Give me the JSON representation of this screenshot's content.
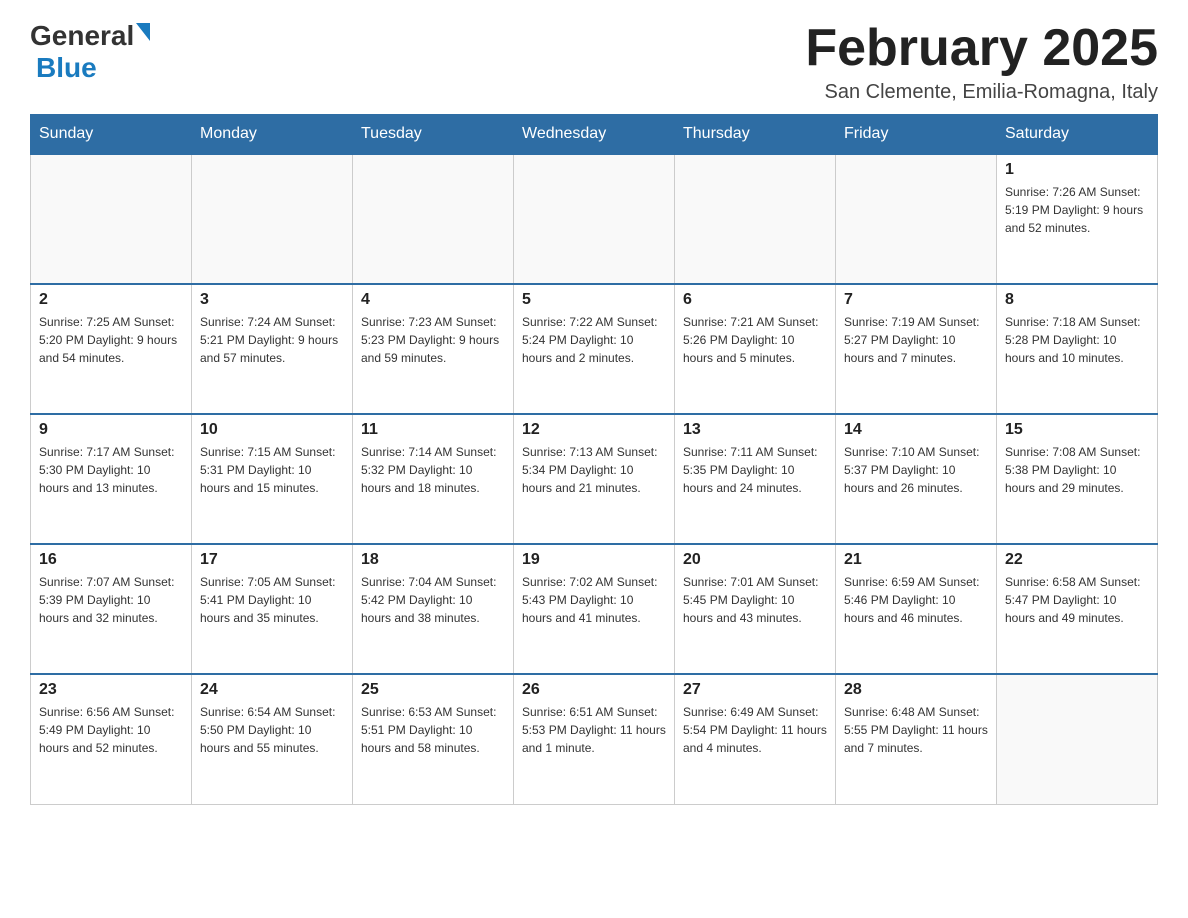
{
  "header": {
    "logo_general": "General",
    "logo_blue": "Blue",
    "title": "February 2025",
    "location": "San Clemente, Emilia-Romagna, Italy"
  },
  "days_of_week": [
    "Sunday",
    "Monday",
    "Tuesday",
    "Wednesday",
    "Thursday",
    "Friday",
    "Saturday"
  ],
  "weeks": [
    [
      {
        "day": "",
        "info": ""
      },
      {
        "day": "",
        "info": ""
      },
      {
        "day": "",
        "info": ""
      },
      {
        "day": "",
        "info": ""
      },
      {
        "day": "",
        "info": ""
      },
      {
        "day": "",
        "info": ""
      },
      {
        "day": "1",
        "info": "Sunrise: 7:26 AM\nSunset: 5:19 PM\nDaylight: 9 hours and 52 minutes."
      }
    ],
    [
      {
        "day": "2",
        "info": "Sunrise: 7:25 AM\nSunset: 5:20 PM\nDaylight: 9 hours and 54 minutes."
      },
      {
        "day": "3",
        "info": "Sunrise: 7:24 AM\nSunset: 5:21 PM\nDaylight: 9 hours and 57 minutes."
      },
      {
        "day": "4",
        "info": "Sunrise: 7:23 AM\nSunset: 5:23 PM\nDaylight: 9 hours and 59 minutes."
      },
      {
        "day": "5",
        "info": "Sunrise: 7:22 AM\nSunset: 5:24 PM\nDaylight: 10 hours and 2 minutes."
      },
      {
        "day": "6",
        "info": "Sunrise: 7:21 AM\nSunset: 5:26 PM\nDaylight: 10 hours and 5 minutes."
      },
      {
        "day": "7",
        "info": "Sunrise: 7:19 AM\nSunset: 5:27 PM\nDaylight: 10 hours and 7 minutes."
      },
      {
        "day": "8",
        "info": "Sunrise: 7:18 AM\nSunset: 5:28 PM\nDaylight: 10 hours and 10 minutes."
      }
    ],
    [
      {
        "day": "9",
        "info": "Sunrise: 7:17 AM\nSunset: 5:30 PM\nDaylight: 10 hours and 13 minutes."
      },
      {
        "day": "10",
        "info": "Sunrise: 7:15 AM\nSunset: 5:31 PM\nDaylight: 10 hours and 15 minutes."
      },
      {
        "day": "11",
        "info": "Sunrise: 7:14 AM\nSunset: 5:32 PM\nDaylight: 10 hours and 18 minutes."
      },
      {
        "day": "12",
        "info": "Sunrise: 7:13 AM\nSunset: 5:34 PM\nDaylight: 10 hours and 21 minutes."
      },
      {
        "day": "13",
        "info": "Sunrise: 7:11 AM\nSunset: 5:35 PM\nDaylight: 10 hours and 24 minutes."
      },
      {
        "day": "14",
        "info": "Sunrise: 7:10 AM\nSunset: 5:37 PM\nDaylight: 10 hours and 26 minutes."
      },
      {
        "day": "15",
        "info": "Sunrise: 7:08 AM\nSunset: 5:38 PM\nDaylight: 10 hours and 29 minutes."
      }
    ],
    [
      {
        "day": "16",
        "info": "Sunrise: 7:07 AM\nSunset: 5:39 PM\nDaylight: 10 hours and 32 minutes."
      },
      {
        "day": "17",
        "info": "Sunrise: 7:05 AM\nSunset: 5:41 PM\nDaylight: 10 hours and 35 minutes."
      },
      {
        "day": "18",
        "info": "Sunrise: 7:04 AM\nSunset: 5:42 PM\nDaylight: 10 hours and 38 minutes."
      },
      {
        "day": "19",
        "info": "Sunrise: 7:02 AM\nSunset: 5:43 PM\nDaylight: 10 hours and 41 minutes."
      },
      {
        "day": "20",
        "info": "Sunrise: 7:01 AM\nSunset: 5:45 PM\nDaylight: 10 hours and 43 minutes."
      },
      {
        "day": "21",
        "info": "Sunrise: 6:59 AM\nSunset: 5:46 PM\nDaylight: 10 hours and 46 minutes."
      },
      {
        "day": "22",
        "info": "Sunrise: 6:58 AM\nSunset: 5:47 PM\nDaylight: 10 hours and 49 minutes."
      }
    ],
    [
      {
        "day": "23",
        "info": "Sunrise: 6:56 AM\nSunset: 5:49 PM\nDaylight: 10 hours and 52 minutes."
      },
      {
        "day": "24",
        "info": "Sunrise: 6:54 AM\nSunset: 5:50 PM\nDaylight: 10 hours and 55 minutes."
      },
      {
        "day": "25",
        "info": "Sunrise: 6:53 AM\nSunset: 5:51 PM\nDaylight: 10 hours and 58 minutes."
      },
      {
        "day": "26",
        "info": "Sunrise: 6:51 AM\nSunset: 5:53 PM\nDaylight: 11 hours and 1 minute."
      },
      {
        "day": "27",
        "info": "Sunrise: 6:49 AM\nSunset: 5:54 PM\nDaylight: 11 hours and 4 minutes."
      },
      {
        "day": "28",
        "info": "Sunrise: 6:48 AM\nSunset: 5:55 PM\nDaylight: 11 hours and 7 minutes."
      },
      {
        "day": "",
        "info": ""
      }
    ]
  ]
}
